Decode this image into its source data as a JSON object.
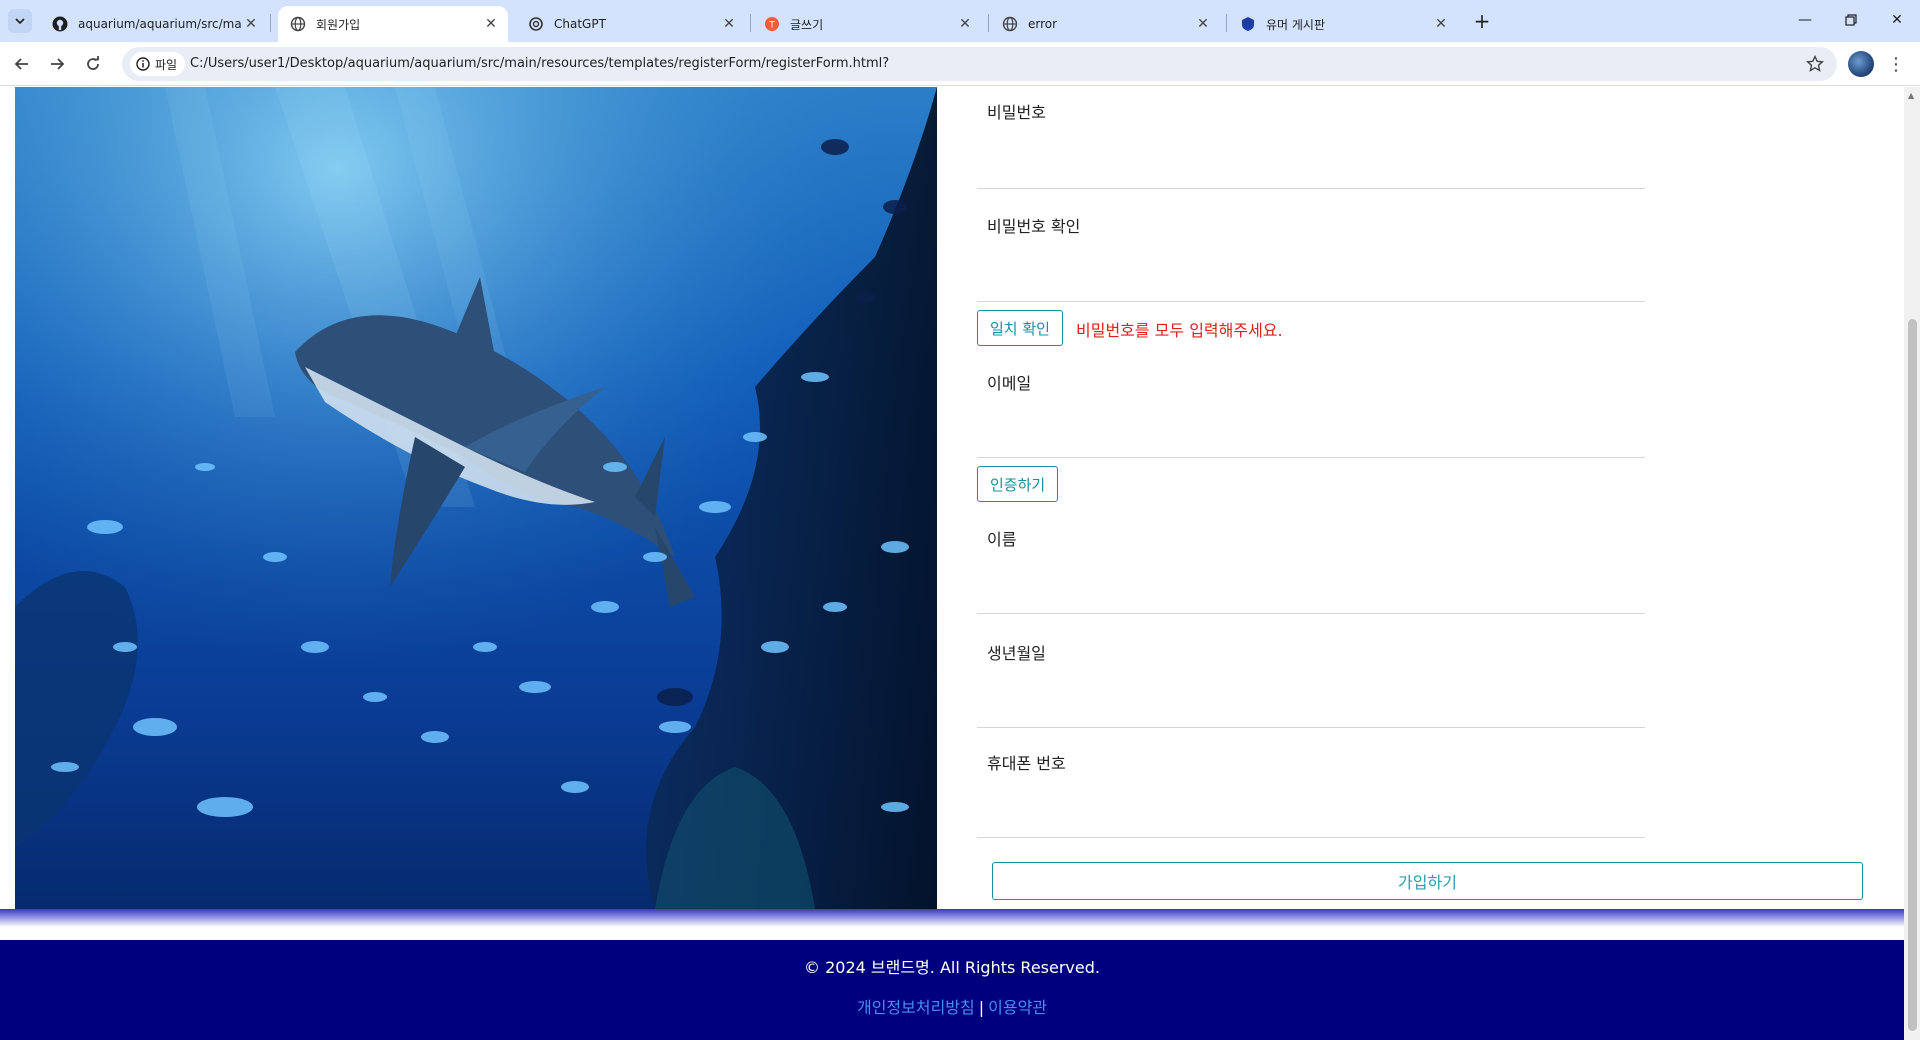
{
  "browser": {
    "tabs": [
      {
        "title": "aquarium/aquarium/src/main/r",
        "icon": "github-icon",
        "active": false
      },
      {
        "title": "회원가입",
        "icon": "globe-icon",
        "active": true
      },
      {
        "title": "ChatGPT",
        "icon": "chatgpt-icon",
        "active": false
      },
      {
        "title": "글쓰기",
        "icon": "tistory-icon",
        "active": false
      },
      {
        "title": "error",
        "icon": "globe-icon",
        "active": false
      },
      {
        "title": "유머 게시판",
        "icon": "shield-icon",
        "active": false
      }
    ],
    "site_info_label": "파일",
    "url": "C:/Users/user1/Desktop/aquarium/aquarium/src/main/resources/templates/registerForm/registerForm.html?"
  },
  "form": {
    "password_label": "비밀번호",
    "password_confirm_label": "비밀번호 확인",
    "match_check_button": "일치 확인",
    "password_message": "비밀번호를 모두 입력해주세요.",
    "email_label": "이메일",
    "verify_button": "인증하기",
    "name_label": "이름",
    "birthdate_label": "생년월일",
    "phone_label": "휴대폰 번호",
    "submit_button": "가입하기"
  },
  "footer": {
    "copyright": "© 2024 브랜드명. All Rights Reserved.",
    "privacy_link": "개인정보처리방침",
    "separator": "|",
    "terms_link": "이용약관"
  },
  "colors": {
    "accent": "#1a8fa0",
    "error": "#e0201a",
    "footer_bg": "#00007e",
    "link": "#4a8cf0"
  }
}
